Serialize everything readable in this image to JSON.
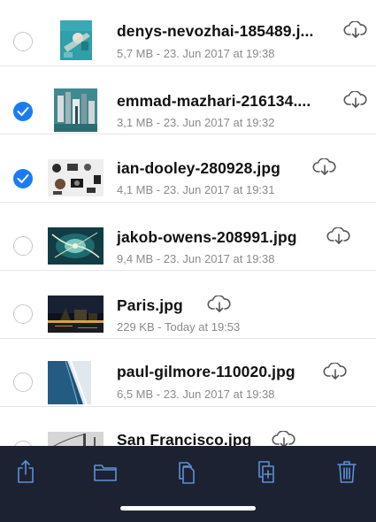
{
  "files": [
    {
      "name": "denys-nevozhai-185489.j...",
      "meta": "5,7 MB - 23. Jun 2017 at 19:38",
      "selected": false,
      "thumbnail": "city-aerial-teal"
    },
    {
      "name": "emmad-mazhari-216134....",
      "meta": "3,1 MB - 23. Jun 2017 at 19:32",
      "selected": true,
      "thumbnail": "city-aerial-skyscrapers"
    },
    {
      "name": "ian-dooley-280928.jpg",
      "meta": "4,1 MB - 23. Jun 2017 at 19:31",
      "selected": true,
      "thumbnail": "desk-flatlay"
    },
    {
      "name": "jakob-owens-208991.jpg",
      "meta": "9,4 MB - 23. Jun 2017 at 19:38",
      "selected": false,
      "thumbnail": "abstract-teal-light"
    },
    {
      "name": "Paris.jpg",
      "meta": "229 KB - Today at 19:53",
      "selected": false,
      "thumbnail": "paris-night"
    },
    {
      "name": "paul-gilmore-110020.jpg",
      "meta": "6,5 MB - 23. Jun 2017 at 19:38",
      "selected": false,
      "thumbnail": "coastline-aerial"
    },
    {
      "name": "San Francisco.jpg",
      "meta": "",
      "selected": false,
      "thumbnail": "golden-gate-bw"
    }
  ],
  "icons": {
    "download": "cloud-download-icon",
    "unchecked": "radio-unchecked-icon",
    "checked": "checkmark-icon"
  },
  "toolbar": {
    "buttons": [
      "share-icon",
      "folder-icon",
      "duplicate-icon",
      "add-copy-icon",
      "trash-icon"
    ]
  },
  "colors": {
    "accent": "#1a7cf5",
    "toolbar_bg": "#1c2231",
    "toolbar_icon": "#5e8fd8",
    "cloud_icon": "#555555"
  }
}
